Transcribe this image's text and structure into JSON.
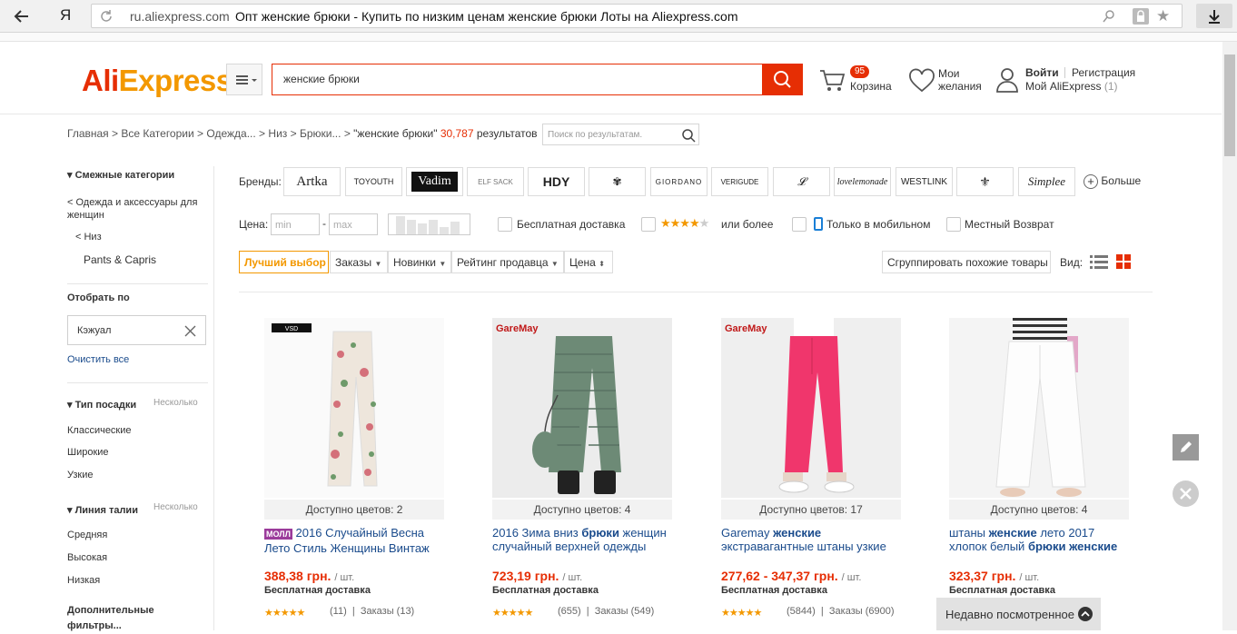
{
  "browser": {
    "logo": "Я",
    "domain": "ru.aliexpress.com",
    "page_title": "Опт женские брюки - Купить по низким ценам женские брюки Лоты на Aliexpress.com"
  },
  "header": {
    "logo_part1": "Ali",
    "logo_part2": "Express",
    "search_value": "женские брюки",
    "cart_badge": "95",
    "cart_label": "Корзина",
    "wishlist_line1": "Мои",
    "wishlist_line2": "желания",
    "signin": "Войти",
    "register": "Регистрация",
    "my_ali": "Мой AliExpress",
    "my_ali_count": "(1)"
  },
  "breadcrumb": {
    "home": "Главная",
    "all_cat": "Все Категории",
    "clothing": "Одежда...",
    "bottoms": "Низ",
    "pants": "Брюки...",
    "query": "\"женские брюки\"",
    "count": "30,787",
    "results": "результатов",
    "search_placeholder": "Поиск по результатам."
  },
  "sidebar": {
    "related_title": "Смежные категории",
    "cat_parent": "< Одежда и аксессуары для женщин",
    "cat_sub": "< Низ",
    "cat_current": "Pants & Capris",
    "filter_by": "Отобрать по",
    "filter_value": "Кэжуал",
    "clear_all": "Очистить все",
    "fit_title": "Тип посадки",
    "fit_multi": "Несколько",
    "fit_items": [
      "Классические",
      "Широкие",
      "Узкие"
    ],
    "waist_title": "Линия талии",
    "waist_multi": "Несколько",
    "waist_items": [
      "Средняя",
      "Высокая",
      "Низкая"
    ],
    "extra_title": "Дополнительные фильтры..."
  },
  "filters": {
    "brands_label": "Бренды:",
    "brands": [
      "Artka",
      "TOYOUTH",
      "Vadim",
      "ELF SACK",
      "HDY",
      "",
      "GIORDANO",
      "VERIGUDE",
      "",
      "",
      "WESTLINK",
      "",
      "Simplee"
    ],
    "more": "Больше",
    "price_label": "Цена:",
    "min_ph": "min",
    "max_ph": "max",
    "free_ship": "Бесплатная доставка",
    "rating_more": "или более",
    "mobile_only": "Только в мобильном",
    "local_return": "Местный Возврат"
  },
  "sort": {
    "best": "Лучший выбор",
    "orders": "Заказы",
    "newest": "Новинки",
    "seller_rating": "Рейтинг продавца",
    "price": "Цена",
    "group_similar": "Сгруппировать похожие товары",
    "view_label": "Вид:"
  },
  "products": [
    {
      "colors": "Доступно цветов: 2",
      "badge": "МОЛЛ",
      "title_plain": "2016 Случайный Весна Лето Стиль Женщины Винтаж",
      "price": "388,38 грн.",
      "unit": "/ шт.",
      "shipping": "Бесплатная доставка",
      "reviews": "(11)",
      "orders": "Заказы (13)",
      "rating": 5,
      "img_color": "#f5f5f5",
      "brand_mark": "VSD"
    },
    {
      "colors": "Доступно цветов: 4",
      "title_html_a": "2016 Зима вниз ",
      "title_html_b": "брюки",
      "title_html_c": " женщин случайный верхней одежды",
      "price": "723,19 грн.",
      "unit": "/ шт.",
      "shipping": "Бесплатная доставка",
      "reviews": "(655)",
      "orders": "Заказы (549)",
      "rating": 5,
      "img_color": "#ebebeb",
      "brand_mark": "GareMay"
    },
    {
      "colors": "Доступно цветов: 17",
      "title_html_a": "Garemay ",
      "title_html_b": "женские",
      "title_html_c": " экстравагантные штаны узкие",
      "price": "277,62 - 347,37 грн.",
      "unit": "/ шт.",
      "shipping": "Бесплатная доставка",
      "reviews": "(5844)",
      "orders": "Заказы (6900)",
      "rating": 5,
      "img_color": "#eeeeee",
      "brand_mark": "GareMay"
    },
    {
      "colors": "Доступно цветов: 4",
      "title_html_a": "штаны ",
      "title_html_b": "женские",
      "title_html_c": " лето 2017 хлопок белый ",
      "title_html_d": "брюки женские",
      "price": "323,37 грн.",
      "unit": "/ шт.",
      "shipping": "Бесплатная доставка",
      "reviews": "",
      "orders": "",
      "rating": 0,
      "img_color": "#f0f0f0"
    }
  ],
  "recently_viewed": "Недавно посмотренное",
  "colors": {
    "brand_red": "#e62e04",
    "brand_orange": "#f39800",
    "link_blue": "#1a4b8c"
  }
}
